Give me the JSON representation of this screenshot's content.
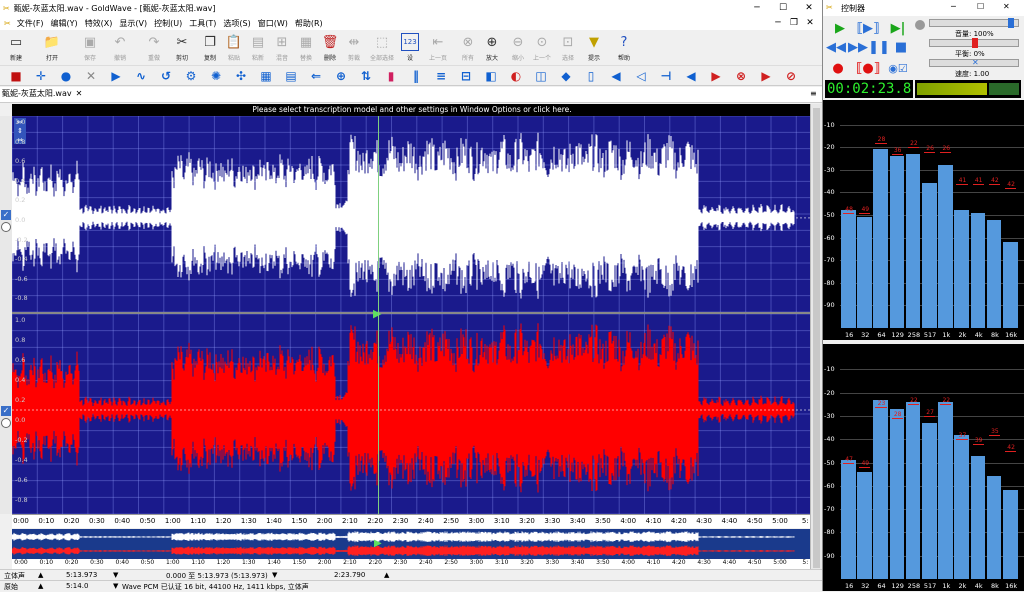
{
  "window": {
    "title": "甄妮-灰蓝太阳.wav - GoldWave - [甄妮-灰蓝太阳.wav]"
  },
  "menu": [
    "文件(F)",
    "编辑(Y)",
    "特效(X)",
    "显示(V)",
    "控制(U)",
    "工具(T)",
    "选项(S)",
    "窗口(W)",
    "帮助(R)"
  ],
  "toolbar": [
    {
      "label": "新建",
      "icon": "new-file-icon",
      "glyph": "▭",
      "dis": false
    },
    {
      "label": "打开",
      "icon": "open-folder-icon",
      "glyph": "📁",
      "dis": false
    },
    {
      "label": "保存",
      "icon": "save-icon",
      "glyph": "▣",
      "dis": true
    },
    {
      "label": "撤销",
      "icon": "undo-icon",
      "glyph": "↶",
      "dis": true
    },
    {
      "label": "重做",
      "icon": "redo-icon",
      "glyph": "↷",
      "dis": true
    },
    {
      "label": "剪切",
      "icon": "cut-icon",
      "glyph": "✂",
      "dis": false
    },
    {
      "label": "复制",
      "icon": "copy-icon",
      "glyph": "❐",
      "dis": false
    },
    {
      "label": "粘贴",
      "icon": "paste-icon",
      "glyph": "📋",
      "dis": true
    },
    {
      "label": "粘新",
      "icon": "paste-new-icon",
      "glyph": "▤",
      "dis": true
    },
    {
      "label": "混音",
      "icon": "mix-icon",
      "glyph": "⊞",
      "dis": true
    },
    {
      "label": "替换",
      "icon": "replace-icon",
      "glyph": "▦",
      "dis": true
    },
    {
      "label": "删除",
      "icon": "delete-icon",
      "glyph": "🗑",
      "dis": false
    },
    {
      "label": "剪裁",
      "icon": "trim-icon",
      "glyph": "⇹",
      "dis": true
    },
    {
      "label": "全部选择",
      "icon": "select-all-icon",
      "glyph": "⬚",
      "dis": true
    },
    {
      "label": "设",
      "icon": "set-marker-icon",
      "glyph": "123",
      "dis": false
    },
    {
      "label": "上一页",
      "icon": "prev-page-icon",
      "glyph": "⇤",
      "dis": true
    },
    {
      "label": "所有",
      "icon": "zoom-all-icon",
      "glyph": "⊗",
      "dis": true
    },
    {
      "label": "放大",
      "icon": "zoom-in-icon",
      "glyph": "⊕",
      "dis": false
    },
    {
      "label": "缩小",
      "icon": "zoom-out-icon",
      "glyph": "⊖",
      "dis": true
    },
    {
      "label": "上一个",
      "icon": "zoom-prev-icon",
      "glyph": "⊙",
      "dis": true
    },
    {
      "label": "选择",
      "icon": "zoom-select-icon",
      "glyph": "⊡",
      "dis": true
    },
    {
      "label": "提示",
      "icon": "cue-icon",
      "glyph": "▼",
      "dis": false
    },
    {
      "label": "帮助",
      "icon": "help-icon",
      "glyph": "?",
      "dis": false
    }
  ],
  "tab": {
    "label": "甄妮-灰蓝太阳.wav"
  },
  "infobar": "Please select transcription model and other settings in Window Options or click here.",
  "ylabels_top": [
    "1.0",
    "0.8",
    "0.6",
    "0.4",
    "0.2",
    "0.0",
    "-0.2",
    "-0.4",
    "-0.6",
    "-0.8"
  ],
  "ylabels_bot": [
    "1.0",
    "0.8",
    "0.6",
    "0.4",
    "0.2",
    "0.0",
    "-0.2",
    "-0.4",
    "-0.6",
    "-0.8"
  ],
  "timeline": [
    "0:00",
    "0:10",
    "0:20",
    "0:30",
    "0:40",
    "0:50",
    "1:00",
    "1:10",
    "1:20",
    "1:30",
    "1:40",
    "1:50",
    "2:00",
    "2:10",
    "2:20",
    "2:30",
    "2:40",
    "2:50",
    "3:00",
    "3:10",
    "3:20",
    "3:30",
    "3:40",
    "3:50",
    "4:00",
    "4:10",
    "4:20",
    "4:30",
    "4:40",
    "4:50",
    "5:00",
    "5:"
  ],
  "status": {
    "channels": "立体声",
    "length": "5:13.973",
    "selection": "0.000 至 5:13.973 (5:13.973)",
    "position": "2:23.790",
    "orig_label": "原始",
    "orig_length": "5:14.0",
    "format": "Wave PCM 已认证 16 bit, 44100 Hz, 1411 kbps, 立体声"
  },
  "control": {
    "title": "控制器",
    "volume": "音量: 100%",
    "balance": "平衡: 0%",
    "speed": "速度: 1.00",
    "time": "00:02:23.8"
  },
  "eq_x": [
    "16",
    "32",
    "64",
    "129",
    "258",
    "517",
    "1k",
    "2k",
    "4k",
    "8k",
    "16k"
  ],
  "eq_y": [
    "-10",
    "-20",
    "-30",
    "-40",
    "-50",
    "-60",
    "-70",
    "-80",
    "-90"
  ],
  "eq_top": {
    "values": [
      -48,
      -51,
      -21,
      -24,
      -23,
      -36,
      -28,
      -48,
      -49,
      -52,
      -62
    ],
    "peaks": [
      "48",
      "49",
      "28",
      "36",
      "22",
      "26",
      "26",
      "41",
      "41",
      "42",
      "42"
    ],
    "peak_levels": [
      -46,
      -46,
      -15,
      -20,
      -17,
      -19,
      -19,
      -33,
      -33,
      -33,
      -35
    ]
  },
  "eq_bot": {
    "values": [
      -49,
      -54,
      -23,
      -27,
      -24,
      -33,
      -24,
      -38,
      -47,
      -56,
      -62
    ],
    "peaks": [
      "47",
      "49",
      "23",
      "28",
      "22",
      "27",
      "22",
      "37",
      "39",
      "35",
      "42"
    ],
    "peak_levels": [
      -47,
      -49,
      -23,
      -28,
      -22,
      -27,
      -22,
      -37,
      -39,
      -35,
      -42
    ]
  },
  "colors": {
    "track_bg": "#1a1a8c",
    "left_wave": "#ffffff",
    "right_wave": "#ff0000",
    "eq_bar": "#5599dd",
    "peak": "#e02020",
    "time": "#2df02d"
  }
}
